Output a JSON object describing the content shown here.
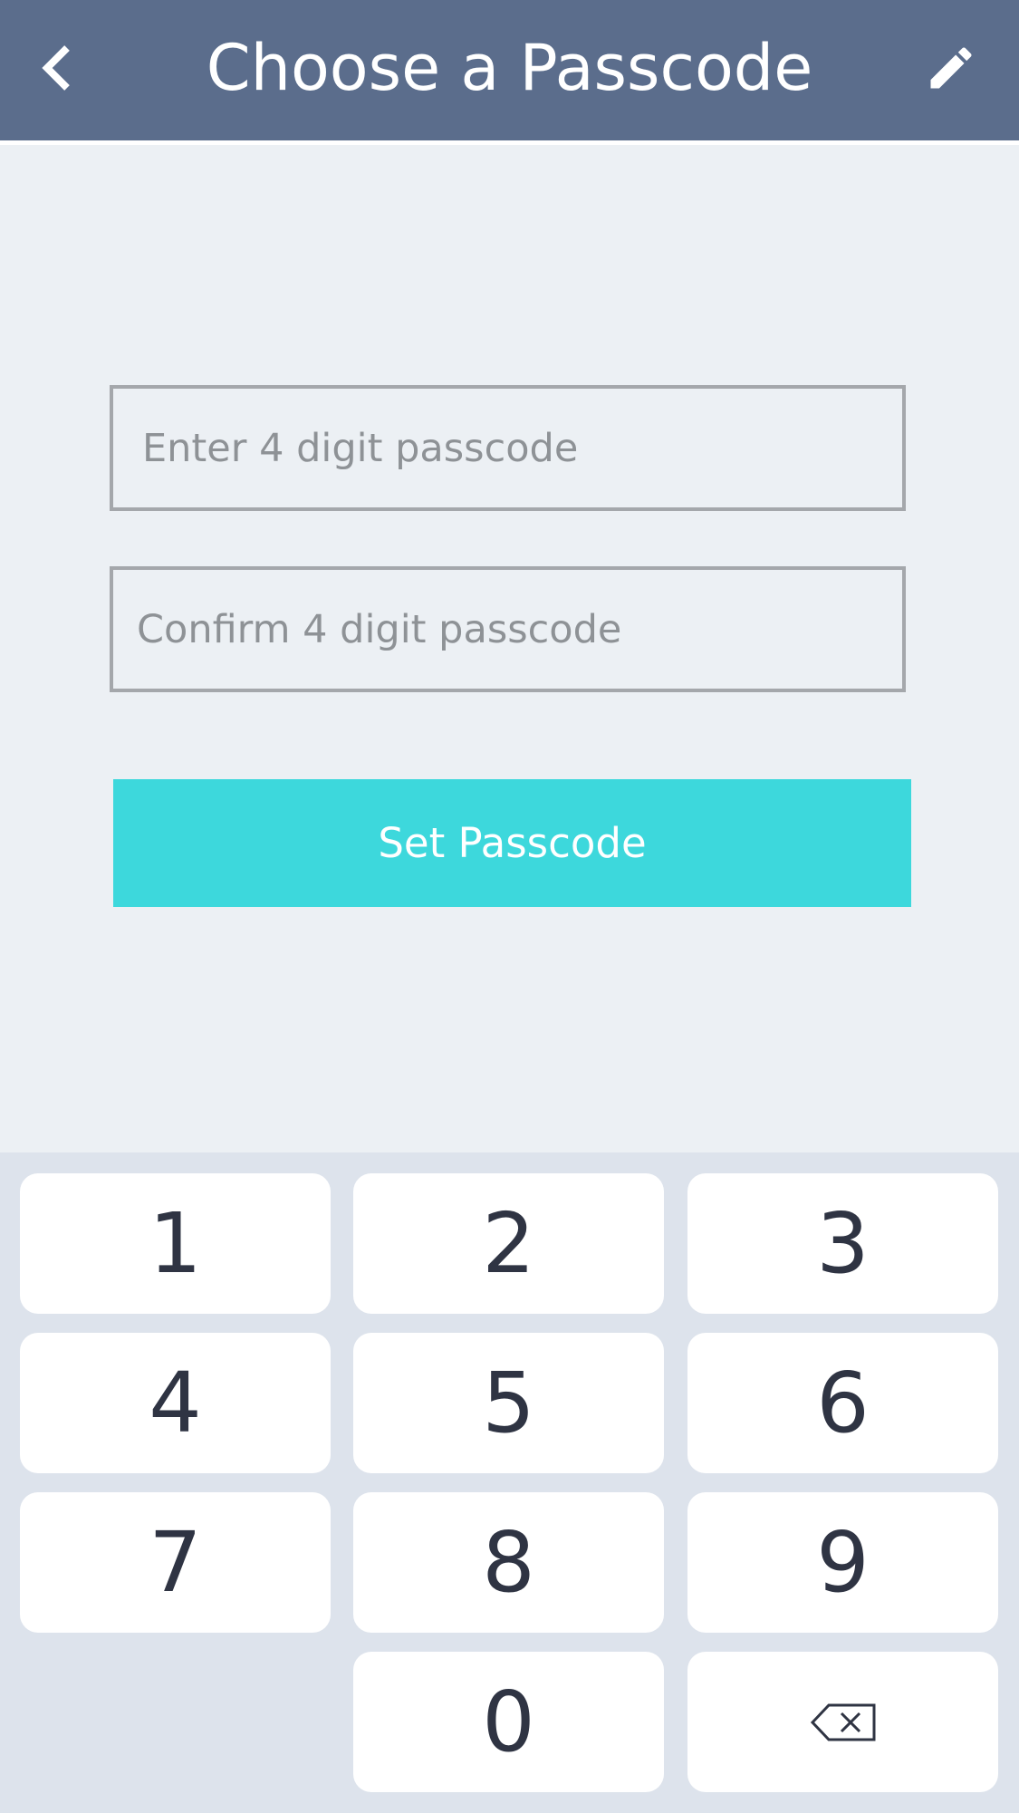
{
  "header": {
    "title": "Choose a Passcode",
    "back_icon": "chevron-left-icon",
    "edit_icon": "pencil-icon"
  },
  "form": {
    "passcode_placeholder": "Enter 4 digit passcode",
    "confirm_placeholder": "Confirm 4 digit passcode",
    "passcode_value": "",
    "confirm_value": "",
    "submit_label": "Set Passcode"
  },
  "keypad": {
    "keys": [
      "1",
      "2",
      "3",
      "4",
      "5",
      "6",
      "7",
      "8",
      "9",
      "0"
    ],
    "backspace_icon": "backspace-icon"
  },
  "colors": {
    "header": "#5b6d8c",
    "accent": "#3dd8dc",
    "background": "#ecf0f4",
    "keypad": "#dde3ec"
  }
}
